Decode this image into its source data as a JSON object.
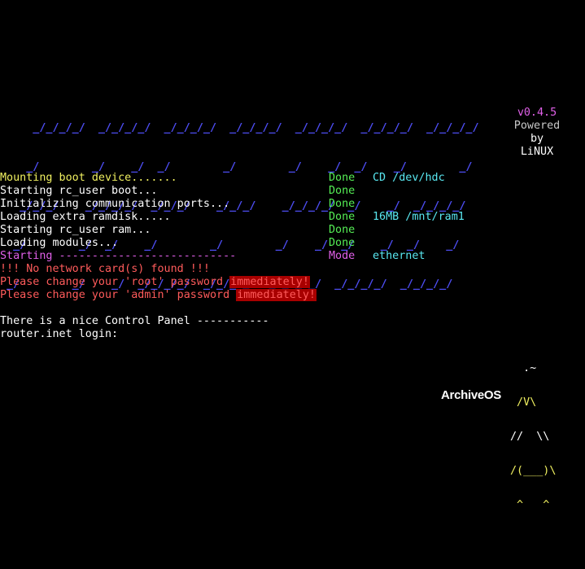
{
  "colors": {
    "background": "#000000",
    "logo": "#4d4df2",
    "white": "#ffffff",
    "yellow": "#f0f060",
    "green": "#55ee55",
    "cyan": "#59e8f1",
    "magenta": "#e060e8",
    "red": "#ff5b5b",
    "red_bg": "#a80000"
  },
  "logo": {
    "lines": [
      "     _/_/_/_/  _/_/_/_/  _/_/_/_/  _/_/_/_/  _/_/_/_/  _/_/_/_/  _/_/_/_/",
      "    _/        _/    _/  _/        _/        _/    _/  _/    _/        _/",
      "   _/_/_/    _/_/_/_/  _/_/_/    _/_/_/    _/_/_/_/  _/    _/  _/_/_/_/ ",
      "  _/        _/  _/    _/        _/        _/    _/  _/    _/  _/    _/  ",
      " _/        _/    _/  _/_/_/_/  _/_/_/_/  _/_/_/_/  _/_/_/_/  _/_/_/_/   "
    ]
  },
  "version": {
    "number": "v0.4.5",
    "powered": "Powered",
    "by": "by",
    "os": "LiNUX"
  },
  "boot": [
    {
      "text": "Mounting boot device.......",
      "status": "Done",
      "detail": "CD /dev/hdc"
    },
    {
      "text": "Starting rc_user boot...",
      "status": "Done",
      "detail": ""
    },
    {
      "text": "Initializing communication ports...",
      "status": "Done",
      "detail": ""
    },
    {
      "text": "Loading extra ramdisk.....",
      "status": "Done",
      "detail": "16MB /mnt/ram1"
    },
    {
      "text": "Starting rc_user ram...",
      "status": "Done",
      "detail": ""
    },
    {
      "text": "Loading modules...",
      "status": "Done",
      "detail": ""
    },
    {
      "text": "Starting ---------------------------",
      "status": "Mode",
      "detail": "ethernet"
    }
  ],
  "warnings": {
    "no_network": "!!! No network card(s) found !!!",
    "root_prefix": "Please change your 'root' password ",
    "admin_prefix": "Please change your 'admin' password ",
    "immediately": "immediately!"
  },
  "control_panel": "There is a nice Control Panel -----------",
  "login_prompt": "router.inet login:",
  "mascot": {
    "lines": [
      "  .~",
      " /V\\",
      "//  \\\\",
      "/(___)\\",
      " ^   ^"
    ]
  },
  "brand": "ArchiveOS"
}
